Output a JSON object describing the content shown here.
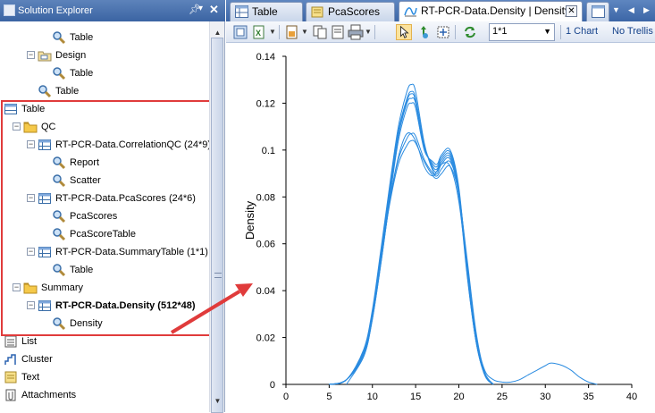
{
  "solution_explorer": {
    "title": "Solution Explorer",
    "items": [
      {
        "label": "Table",
        "icon": "search-icon",
        "indent": 3,
        "expander": "",
        "bold": false
      },
      {
        "label": "Design",
        "icon": "design-folder-icon",
        "indent": 2,
        "expander": "−",
        "bold": false
      },
      {
        "label": "Table",
        "icon": "search-icon",
        "indent": 3,
        "expander": "",
        "bold": false
      },
      {
        "label": "Table",
        "icon": "search-icon",
        "indent": 2,
        "expander": "",
        "bold": false
      },
      {
        "label": "Table",
        "icon": "table-icon",
        "indent": 0,
        "expander": "",
        "bold": false
      },
      {
        "label": "QC",
        "icon": "folder-icon",
        "indent": 1,
        "expander": "−",
        "bold": false
      },
      {
        "label": "RT-PCR-Data.CorrelationQC (24*9)",
        "icon": "grid-icon",
        "indent": 2,
        "expander": "−",
        "bold": false
      },
      {
        "label": "Report",
        "icon": "search-icon",
        "indent": 3,
        "expander": "",
        "bold": false
      },
      {
        "label": "Scatter",
        "icon": "search-icon",
        "indent": 3,
        "expander": "",
        "bold": false
      },
      {
        "label": "RT-PCR-Data.PcaScores (24*6)",
        "icon": "grid-icon",
        "indent": 2,
        "expander": "−",
        "bold": false
      },
      {
        "label": "PcaScores",
        "icon": "search-icon",
        "indent": 3,
        "expander": "",
        "bold": false
      },
      {
        "label": "PcaScoreTable",
        "icon": "search-icon",
        "indent": 3,
        "expander": "",
        "bold": false
      },
      {
        "label": "RT-PCR-Data.SummaryTable (1*1)",
        "icon": "grid-icon",
        "indent": 2,
        "expander": "−",
        "bold": false
      },
      {
        "label": "Table",
        "icon": "search-icon",
        "indent": 3,
        "expander": "",
        "bold": false
      },
      {
        "label": "Summary",
        "icon": "folder-icon",
        "indent": 1,
        "expander": "−",
        "bold": false
      },
      {
        "label": "RT-PCR-Data.Density (512*48)",
        "icon": "grid-icon",
        "indent": 2,
        "expander": "−",
        "bold": true
      },
      {
        "label": "Density",
        "icon": "search-icon",
        "indent": 3,
        "expander": "",
        "bold": false
      },
      {
        "label": "List",
        "icon": "list-icon",
        "indent": 0,
        "expander": "",
        "bold": false
      },
      {
        "label": "Cluster",
        "icon": "cluster-icon",
        "indent": 0,
        "expander": "",
        "bold": false
      },
      {
        "label": "Text",
        "icon": "text-icon",
        "indent": 0,
        "expander": "",
        "bold": false
      },
      {
        "label": "Attachments",
        "icon": "attachments-icon",
        "indent": 0,
        "expander": "",
        "bold": false
      }
    ]
  },
  "tabs": [
    {
      "label": "Table",
      "active": false,
      "closable": false
    },
    {
      "label": "PcaScores",
      "active": false,
      "closable": false
    },
    {
      "label": "RT-PCR-Data.Density | Density",
      "active": true,
      "closable": true
    },
    {
      "label": "",
      "active": false,
      "closable": false
    }
  ],
  "toolbar": {
    "layout_value": "1*1",
    "chart_count": "1 Chart",
    "trellis": "No Trellis"
  },
  "colors": {
    "accent": "#3c66a6",
    "highlight_box": "#e03b3b",
    "curve": "#2a8be0"
  },
  "chart_data": {
    "type": "line",
    "title": "",
    "xlabel": "",
    "ylabel": "Density",
    "xlim": [
      0,
      40
    ],
    "ylim": [
      0,
      0.14
    ],
    "x_ticks": [
      0,
      5,
      10,
      15,
      20,
      25,
      30,
      35,
      40
    ],
    "y_ticks": [
      "0",
      "0.02",
      "0.04",
      "0.06",
      "0.08",
      "0.1",
      "0.12",
      "0.14"
    ],
    "y_tick_values": [
      0,
      0.02,
      0.04,
      0.06,
      0.08,
      0.1,
      0.12,
      0.14
    ],
    "grid": false,
    "legend": "none",
    "series": [
      {
        "x": [
          5,
          7,
          9,
          10,
          11,
          12,
          13,
          14,
          14.5,
          15,
          16,
          17,
          17.5,
          18,
          19,
          20,
          21,
          22,
          23,
          24
        ],
        "values": [
          0,
          0.002,
          0.015,
          0.032,
          0.058,
          0.085,
          0.11,
          0.125,
          0.128,
          0.125,
          0.103,
          0.091,
          0.09,
          0.094,
          0.096,
          0.08,
          0.045,
          0.018,
          0.004,
          0
        ]
      },
      {
        "x": [
          5,
          7,
          9,
          10,
          11,
          12,
          13,
          14,
          14.5,
          15,
          16,
          17,
          17.5,
          18,
          19,
          20,
          21,
          22,
          23,
          24
        ],
        "values": [
          0,
          0.002,
          0.014,
          0.03,
          0.056,
          0.083,
          0.108,
          0.122,
          0.125,
          0.122,
          0.102,
          0.093,
          0.092,
          0.096,
          0.098,
          0.082,
          0.046,
          0.018,
          0.004,
          0
        ]
      },
      {
        "x": [
          5,
          7,
          9,
          10,
          11,
          12,
          13,
          14,
          14.5,
          15,
          16,
          17,
          17.5,
          18,
          19,
          20,
          21,
          22,
          23,
          24
        ],
        "values": [
          0,
          0.002,
          0.013,
          0.029,
          0.054,
          0.081,
          0.106,
          0.12,
          0.122,
          0.12,
          0.101,
          0.094,
          0.093,
          0.097,
          0.099,
          0.083,
          0.047,
          0.019,
          0.004,
          0
        ]
      },
      {
        "x": [
          5,
          7,
          9,
          10,
          11,
          12,
          13,
          14,
          14.5,
          15,
          16,
          17,
          17.5,
          18,
          19,
          20,
          21,
          22,
          23,
          24
        ],
        "values": [
          0,
          0.002,
          0.012,
          0.028,
          0.052,
          0.079,
          0.104,
          0.118,
          0.12,
          0.118,
          0.1,
          0.095,
          0.094,
          0.098,
          0.1,
          0.084,
          0.048,
          0.019,
          0.004,
          0
        ]
      },
      {
        "x": [
          5,
          7,
          9,
          10,
          11,
          12,
          13,
          14,
          14.5,
          15,
          16,
          17,
          17.5,
          18,
          19,
          20,
          21,
          22,
          23,
          24
        ],
        "values": [
          0,
          0.002,
          0.013,
          0.029,
          0.055,
          0.082,
          0.107,
          0.121,
          0.124,
          0.121,
          0.102,
          0.092,
          0.091,
          0.095,
          0.097,
          0.081,
          0.046,
          0.018,
          0.004,
          0
        ]
      },
      {
        "x": [
          5,
          7,
          9,
          10,
          11,
          12,
          13,
          14,
          14.5,
          15,
          16,
          17,
          17.5,
          18,
          19,
          20,
          21,
          22,
          23,
          24
        ],
        "values": [
          0,
          0.002,
          0.014,
          0.03,
          0.053,
          0.078,
          0.096,
          0.105,
          0.107,
          0.106,
          0.096,
          0.09,
          0.089,
          0.092,
          0.095,
          0.082,
          0.05,
          0.02,
          0.005,
          0
        ]
      },
      {
        "x": [
          5,
          7,
          9,
          10,
          11,
          12,
          13,
          14,
          14.5,
          15,
          16,
          17,
          17.5,
          18,
          19,
          20,
          21,
          22,
          23,
          24
        ],
        "values": [
          0,
          0.002,
          0.014,
          0.031,
          0.054,
          0.077,
          0.094,
          0.102,
          0.104,
          0.103,
          0.095,
          0.089,
          0.088,
          0.09,
          0.093,
          0.081,
          0.052,
          0.022,
          0.005,
          0
        ]
      },
      {
        "x": [
          7,
          9,
          10,
          11,
          12,
          13,
          14,
          15,
          16,
          17,
          18,
          19,
          20,
          21,
          22,
          23,
          24,
          25,
          26,
          27,
          28,
          29,
          30,
          30.5,
          31,
          32,
          33,
          34,
          35,
          36
        ],
        "values": [
          0,
          0.012,
          0.028,
          0.052,
          0.078,
          0.097,
          0.107,
          0.104,
          0.093,
          0.089,
          0.094,
          0.093,
          0.078,
          0.048,
          0.02,
          0.006,
          0.002,
          0.001,
          0.001,
          0.002,
          0.004,
          0.006,
          0.008,
          0.009,
          0.009,
          0.008,
          0.006,
          0.003,
          0.001,
          0
        ]
      }
    ]
  }
}
